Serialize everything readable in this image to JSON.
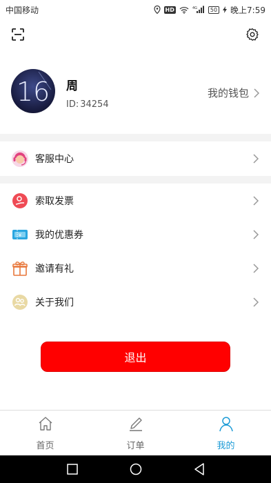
{
  "status_bar": {
    "carrier": "中国移动",
    "hd_badge": "HD",
    "network": "4G",
    "battery": "50",
    "time": "晚上7:59"
  },
  "toolbar": {
    "scan_icon": "scan-icon",
    "settings_icon": "gear-icon"
  },
  "profile": {
    "avatar_text": "16",
    "name": "周",
    "id_label": "ID:",
    "id_value": "34254",
    "wallet_label": "我的钱包"
  },
  "menu": {
    "customer_service": {
      "label": "客服中心",
      "icon": "customer-service-icon"
    },
    "items": [
      {
        "label": "索取发票",
        "icon": "invoice-icon"
      },
      {
        "label": "我的优惠券",
        "icon": "coupon-icon"
      },
      {
        "label": "邀请有礼",
        "icon": "gift-icon"
      },
      {
        "label": "关于我们",
        "icon": "about-us-icon"
      }
    ]
  },
  "logout_label": "退出",
  "tabs": [
    {
      "label": "首页",
      "icon": "home-icon",
      "active": false
    },
    {
      "label": "订单",
      "icon": "pencil-icon",
      "active": false
    },
    {
      "label": "我的",
      "icon": "person-icon",
      "active": true
    }
  ],
  "colors": {
    "logout": "#ff0000",
    "active_tab": "#1a9ad6"
  }
}
